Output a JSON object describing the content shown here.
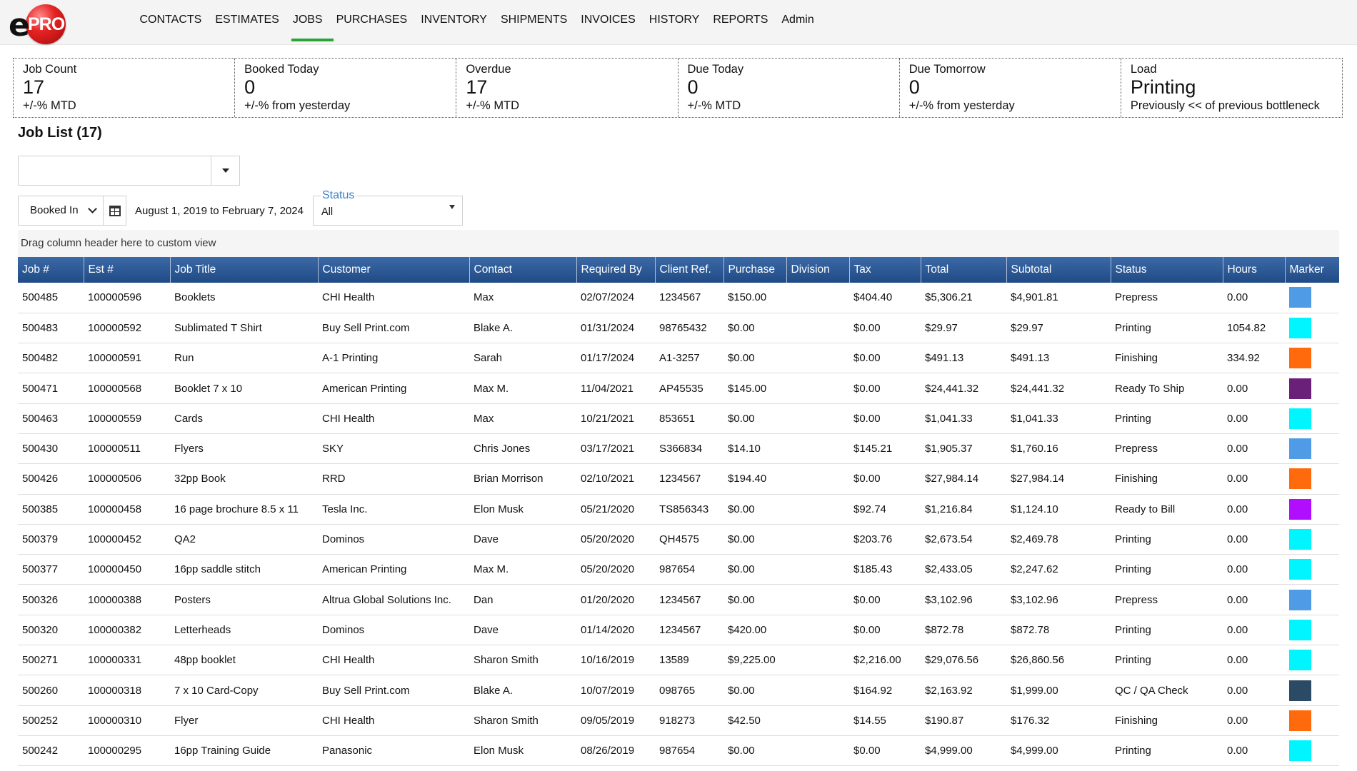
{
  "app": {
    "logo_e": "e",
    "logo_pro": "PRO"
  },
  "nav": {
    "items": [
      {
        "label": "CONTACTS",
        "active": false
      },
      {
        "label": "ESTIMATES",
        "active": false
      },
      {
        "label": "JOBS",
        "active": true
      },
      {
        "label": "PURCHASES",
        "active": false
      },
      {
        "label": "INVENTORY",
        "active": false
      },
      {
        "label": "SHIPMENTS",
        "active": false
      },
      {
        "label": "INVOICES",
        "active": false
      },
      {
        "label": "HISTORY",
        "active": false
      },
      {
        "label": "REPORTS",
        "active": false
      },
      {
        "label": "Admin",
        "active": false
      }
    ]
  },
  "kpis": [
    {
      "label": "Job Count",
      "value": "17",
      "sub": "+/-% MTD"
    },
    {
      "label": "Booked Today",
      "value": "0",
      "sub": "+/-% from yesterday"
    },
    {
      "label": "Overdue",
      "value": "17",
      "sub": "+/-% MTD"
    },
    {
      "label": "Due Today",
      "value": "0",
      "sub": "+/-% MTD"
    },
    {
      "label": "Due Tomorrow",
      "value": "0",
      "sub": "+/-% from yesterday"
    },
    {
      "label": "Load",
      "value": "Printing",
      "sub": "Previously << of previous bottleneck"
    }
  ],
  "job_list": {
    "title": "Job List (17)"
  },
  "filters": {
    "search_value": "",
    "date_field": "Booked In",
    "date_range": "August 1, 2019 to February 7, 2024",
    "status_label": "Status",
    "status_value": "All",
    "drag_hint": "Drag column header here to custom view"
  },
  "table": {
    "columns": [
      "Job #",
      "Est #",
      "Job Title",
      "Customer",
      "Contact",
      "Required By",
      "Client Ref.",
      "Purchase",
      "Division",
      "Tax",
      "Total",
      "Subtotal",
      "Status",
      "Hours",
      "Marker"
    ],
    "rows": [
      {
        "job": "500485",
        "est": "100000596",
        "title": "Booklets",
        "customer": "CHI Health",
        "contact": "Max",
        "required": "02/07/2024",
        "ref": "1234567",
        "purchase": "$150.00",
        "division": "",
        "tax": "$404.40",
        "total": "$5,306.21",
        "subtotal": "$4,901.81",
        "status": "Prepress",
        "hours": "0.00",
        "marker": "#4f9be6"
      },
      {
        "job": "500483",
        "est": "100000592",
        "title": "Sublimated T Shirt",
        "customer": "Buy Sell Print.com",
        "contact": "Blake A.",
        "required": "01/31/2024",
        "ref": "98765432",
        "purchase": "$0.00",
        "division": "",
        "tax": "$0.00",
        "total": "$29.97",
        "subtotal": "$29.97",
        "status": "Printing",
        "hours": "1054.82",
        "marker": "#00f5ff"
      },
      {
        "job": "500482",
        "est": "100000591",
        "title": "Run",
        "customer": "A-1 Printing",
        "contact": "Sarah",
        "required": "01/17/2024",
        "ref": "A1-3257",
        "purchase": "$0.00",
        "division": "",
        "tax": "$0.00",
        "total": "$491.13",
        "subtotal": "$491.13",
        "status": "Finishing",
        "hours": "334.92",
        "marker": "#ff6a0d"
      },
      {
        "job": "500471",
        "est": "100000568",
        "title": "Booklet 7 x 10",
        "customer": "American Printing",
        "contact": "Max M.",
        "required": "11/04/2021",
        "ref": "AP45535",
        "purchase": "$145.00",
        "division": "",
        "tax": "$0.00",
        "total": "$24,441.32",
        "subtotal": "$24,441.32",
        "status": "Ready To Ship",
        "hours": "0.00",
        "marker": "#6a1f78"
      },
      {
        "job": "500463",
        "est": "100000559",
        "title": "Cards",
        "customer": "CHI Health",
        "contact": "Max",
        "required": "10/21/2021",
        "ref": "853651",
        "purchase": "$0.00",
        "division": "",
        "tax": "$0.00",
        "total": "$1,041.33",
        "subtotal": "$1,041.33",
        "status": "Printing",
        "hours": "0.00",
        "marker": "#00f5ff"
      },
      {
        "job": "500430",
        "est": "100000511",
        "title": "Flyers",
        "customer": "SKY",
        "contact": "Chris Jones",
        "required": "03/17/2021",
        "ref": "S366834",
        "purchase": "$14.10",
        "division": "",
        "tax": "$145.21",
        "total": "$1,905.37",
        "subtotal": "$1,760.16",
        "status": "Prepress",
        "hours": "0.00",
        "marker": "#4f9be6"
      },
      {
        "job": "500426",
        "est": "100000506",
        "title": "32pp Book",
        "customer": "RRD",
        "contact": "Brian Morrison",
        "required": "02/10/2021",
        "ref": "1234567",
        "purchase": "$194.40",
        "division": "",
        "tax": "$0.00",
        "total": "$27,984.14",
        "subtotal": "$27,984.14",
        "status": "Finishing",
        "hours": "0.00",
        "marker": "#ff6a0d"
      },
      {
        "job": "500385",
        "est": "100000458",
        "title": "16 page brochure 8.5 x 11",
        "customer": "Tesla Inc.",
        "contact": "Elon Musk",
        "required": "05/21/2020",
        "ref": "TS856343",
        "purchase": "$0.00",
        "division": "",
        "tax": "$92.74",
        "total": "$1,216.84",
        "subtotal": "$1,124.10",
        "status": "Ready to Bill",
        "hours": "0.00",
        "marker": "#b10dff"
      },
      {
        "job": "500379",
        "est": "100000452",
        "title": "QA2",
        "customer": "Dominos",
        "contact": "Dave",
        "required": "05/20/2020",
        "ref": "QH4575",
        "purchase": "$0.00",
        "division": "",
        "tax": "$203.76",
        "total": "$2,673.54",
        "subtotal": "$2,469.78",
        "status": "Printing",
        "hours": "0.00",
        "marker": "#00f5ff"
      },
      {
        "job": "500377",
        "est": "100000450",
        "title": "16pp saddle stitch",
        "customer": "American Printing",
        "contact": "Max M.",
        "required": "05/20/2020",
        "ref": "987654",
        "purchase": "$0.00",
        "division": "",
        "tax": "$185.43",
        "total": "$2,433.05",
        "subtotal": "$2,247.62",
        "status": "Printing",
        "hours": "0.00",
        "marker": "#00f5ff"
      },
      {
        "job": "500326",
        "est": "100000388",
        "title": "Posters",
        "customer": "Altrua Global Solutions Inc.",
        "contact": "Dan",
        "required": "01/20/2020",
        "ref": "1234567",
        "purchase": "$0.00",
        "division": "",
        "tax": "$0.00",
        "total": "$3,102.96",
        "subtotal": "$3,102.96",
        "status": "Prepress",
        "hours": "0.00",
        "marker": "#4f9be6"
      },
      {
        "job": "500320",
        "est": "100000382",
        "title": "Letterheads",
        "customer": "Dominos",
        "contact": "Dave",
        "required": "01/14/2020",
        "ref": "1234567",
        "purchase": "$420.00",
        "division": "",
        "tax": "$0.00",
        "total": "$872.78",
        "subtotal": "$872.78",
        "status": "Printing",
        "hours": "0.00",
        "marker": "#00f5ff"
      },
      {
        "job": "500271",
        "est": "100000331",
        "title": "48pp booklet",
        "customer": "CHI Health",
        "contact": "Sharon Smith",
        "required": "10/16/2019",
        "ref": "13589",
        "purchase": "$9,225.00",
        "division": "",
        "tax": "$2,216.00",
        "total": "$29,076.56",
        "subtotal": "$26,860.56",
        "status": "Printing",
        "hours": "0.00",
        "marker": "#00f5ff"
      },
      {
        "job": "500260",
        "est": "100000318",
        "title": "7 x 10 Card-Copy",
        "customer": "Buy Sell Print.com",
        "contact": "Blake A.",
        "required": "10/07/2019",
        "ref": "098765",
        "purchase": "$0.00",
        "division": "",
        "tax": "$164.92",
        "total": "$2,163.92",
        "subtotal": "$1,999.00",
        "status": "QC / QA Check",
        "hours": "0.00",
        "marker": "#2b4a66"
      },
      {
        "job": "500252",
        "est": "100000310",
        "title": "Flyer",
        "customer": "CHI Health",
        "contact": "Sharon Smith",
        "required": "09/05/2019",
        "ref": "918273",
        "purchase": "$42.50",
        "division": "",
        "tax": "$14.55",
        "total": "$190.87",
        "subtotal": "$176.32",
        "status": "Finishing",
        "hours": "0.00",
        "marker": "#ff6a0d"
      },
      {
        "job": "500242",
        "est": "100000295",
        "title": "16pp Training Guide",
        "customer": "Panasonic",
        "contact": "Elon Musk",
        "required": "08/26/2019",
        "ref": "987654",
        "purchase": "$0.00",
        "division": "",
        "tax": "$0.00",
        "total": "$4,999.00",
        "subtotal": "$4,999.00",
        "status": "Printing",
        "hours": "0.00",
        "marker": "#00f5ff"
      }
    ]
  }
}
